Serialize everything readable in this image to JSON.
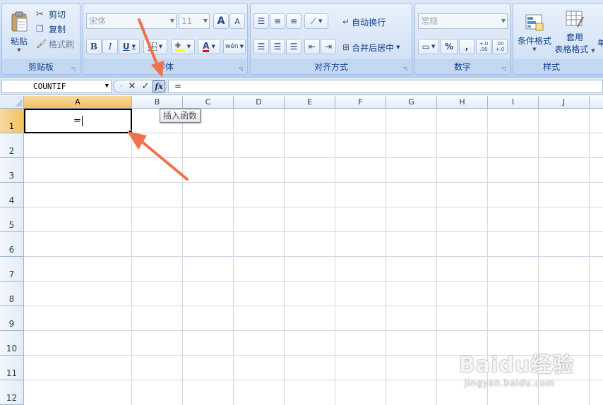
{
  "ribbon": {
    "clipboard": {
      "label": "剪贴板",
      "paste": "粘贴",
      "cut": "剪切",
      "copy": "复制",
      "format_painter": "格式刷"
    },
    "font": {
      "label": "字体",
      "font_name": "宋体",
      "font_size": "11",
      "grow": "A",
      "shrink": "A",
      "bold": "B",
      "italic": "I",
      "underline": "U",
      "font_color": "A",
      "phonetic": "wén"
    },
    "alignment": {
      "label": "对齐方式",
      "wrap_text": "自动换行",
      "merge_center": "合并后居中"
    },
    "number": {
      "label": "数字",
      "format": "常规",
      "percent": "%",
      "comma": ",",
      "inc_decimal": "+.0\n.00",
      "dec_decimal": ".00\n+.0"
    },
    "styles": {
      "label": "样式",
      "conditional": "条件格式",
      "table_format_1": "套用",
      "table_format_2": "表格格式",
      "cell_styles": "单"
    }
  },
  "formula_bar": {
    "name_box": "COUNTIF",
    "cancel": "✕",
    "enter": "✓",
    "fx": "fx",
    "content": "="
  },
  "tooltip": "插入函数",
  "columns": [
    "A",
    "B",
    "C",
    "D",
    "E",
    "F",
    "G",
    "H",
    "I",
    "J"
  ],
  "rows": [
    "1",
    "2",
    "3",
    "4",
    "5",
    "6",
    "7",
    "8",
    "9",
    "10",
    "11",
    "12"
  ],
  "active_cell_value": "=",
  "watermark": {
    "main": "Baidu经验",
    "sub": "jingyan.baidu.com"
  },
  "colors": {
    "accent_arrow": "#f0724a",
    "active_header": "#f1c15f",
    "ribbon_text": "#15428b"
  }
}
